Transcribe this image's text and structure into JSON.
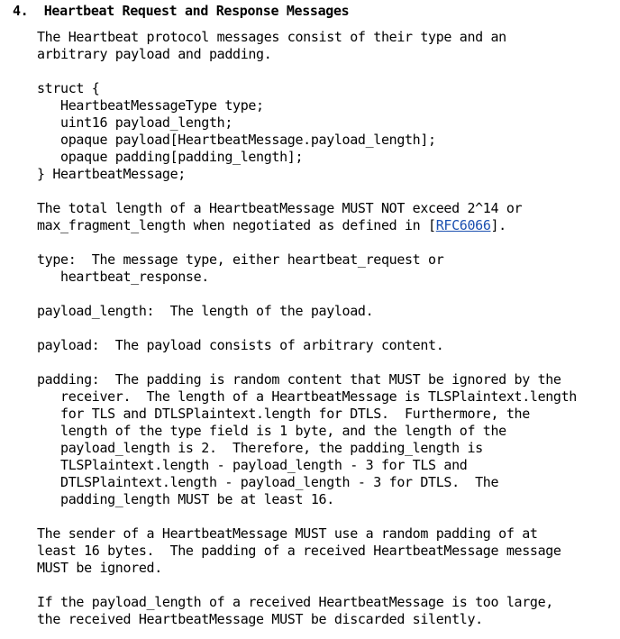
{
  "section": {
    "number": "4.",
    "title": "Heartbeat Request and Response Messages"
  },
  "para_intro": [
    "The Heartbeat protocol messages consist of their type and an",
    "arbitrary payload and padding."
  ],
  "struct_block": [
    "struct {",
    "   HeartbeatMessageType type;",
    "   uint16 payload_length;",
    "   opaque payload[HeartbeatMessage.payload_length];",
    "   opaque padding[padding_length];",
    "} HeartbeatMessage;"
  ],
  "para_length": {
    "line1": "The total length of a HeartbeatMessage MUST NOT exceed 2^14 or",
    "line2_before": "max_fragment_length when negotiated as defined in [",
    "link_text": "RFC6066",
    "line2_after": "]."
  },
  "def_type": [
    "type:  The message type, either heartbeat_request or",
    "   heartbeat_response."
  ],
  "def_payload_length": [
    "payload_length:  The length of the payload."
  ],
  "def_payload": [
    "payload:  The payload consists of arbitrary content."
  ],
  "def_padding": [
    "padding:  The padding is random content that MUST be ignored by the",
    "   receiver.  The length of a HeartbeatMessage is TLSPlaintext.length",
    "   for TLS and DTLSPlaintext.length for DTLS.  Furthermore, the",
    "   length of the type field is 1 byte, and the length of the",
    "   payload_length is 2.  Therefore, the padding_length is",
    "   TLSPlaintext.length - payload_length - 3 for TLS and",
    "   DTLSPlaintext.length - payload_length - 3 for DTLS.  The",
    "   padding_length MUST be at least 16."
  ],
  "para_sender": [
    "The sender of a HeartbeatMessage MUST use a random padding of at",
    "least 16 bytes.  The padding of a received HeartbeatMessage message",
    "MUST be ignored."
  ],
  "para_discard": [
    "If the payload_length of a received HeartbeatMessage is too large,",
    "the received HeartbeatMessage MUST be discarded silently."
  ]
}
